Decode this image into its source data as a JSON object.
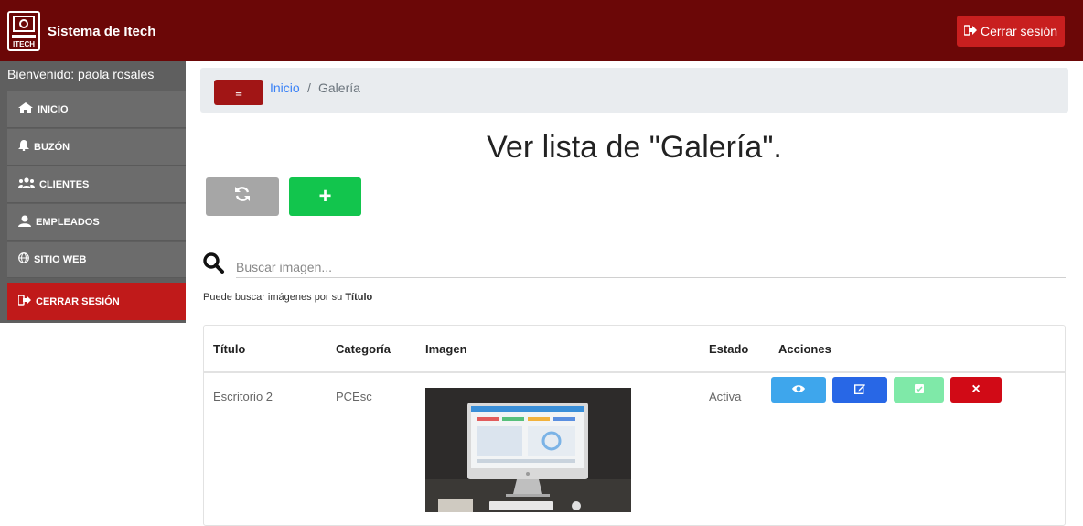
{
  "app": {
    "title": "Sistema de Itech",
    "logout_label": "Cerrar sesión"
  },
  "sidebar": {
    "welcome": "Bienvenido: paola rosales",
    "items": [
      {
        "label": "INICIO",
        "icon": "home-icon"
      },
      {
        "label": "BUZÓN",
        "icon": "bell-icon"
      },
      {
        "label": "CLIENTES",
        "icon": "users-icon"
      },
      {
        "label": "EMPLEADOS",
        "icon": "user-icon"
      },
      {
        "label": "SITIO WEB",
        "icon": "globe-icon"
      },
      {
        "label": "CERRAR SESIÓN",
        "icon": "sign-out-icon"
      }
    ]
  },
  "breadcrumb": {
    "toggle": "≡",
    "home": "Inicio",
    "separator": "/",
    "current": "Galería"
  },
  "page": {
    "title": "Ver lista de \"Galería\"."
  },
  "toolbar": {
    "refresh_icon": "refresh-icon",
    "add_label": "+"
  },
  "search": {
    "placeholder": "Buscar imagen...",
    "help_prefix": "Puede buscar imágenes por su ",
    "help_field": "Título"
  },
  "table": {
    "columns": [
      "Título",
      "Categoría",
      "Imagen",
      "Estado",
      "Acciones"
    ],
    "rows": [
      {
        "titulo": "Escritorio 2",
        "categoria": "PCEsc",
        "estado": "Activa"
      }
    ],
    "actions": {
      "view_icon": "eye-icon",
      "edit_icon": "edit-icon",
      "status_icon": "check-square-icon",
      "delete_label": "×"
    }
  },
  "colors": {
    "topbar": "#6b0707",
    "danger": "#c01a1a",
    "success": "#12c54d",
    "info": "#3ea6ec",
    "primary": "#2867e6"
  }
}
